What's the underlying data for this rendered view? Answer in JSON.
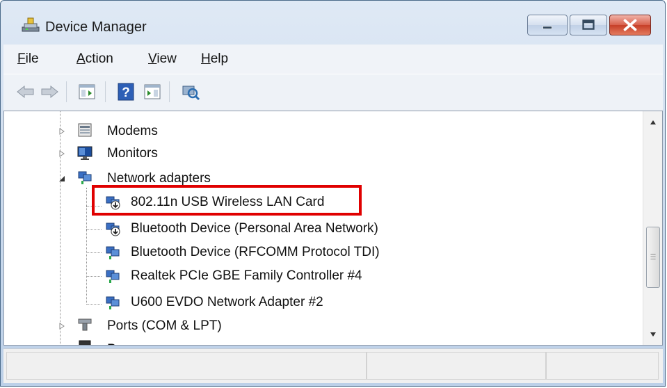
{
  "window": {
    "title": "Device Manager",
    "icon": "computer-management-icon"
  },
  "menu": {
    "items": [
      {
        "label": "File",
        "accel": "F"
      },
      {
        "label": "Action",
        "accel": "A"
      },
      {
        "label": "View",
        "accel": "V"
      },
      {
        "label": "Help",
        "accel": "H"
      }
    ]
  },
  "toolbar": {
    "buttons": [
      "back-icon",
      "forward-icon",
      "show-hide-console-tree-icon",
      "help-icon",
      "show-hide-action-pane-icon",
      "scan-hardware-changes-icon"
    ]
  },
  "tree": {
    "items": [
      {
        "label": "Modems",
        "icon": "modem-icon",
        "expanded": false
      },
      {
        "label": "Monitors",
        "icon": "monitor-icon",
        "expanded": false
      },
      {
        "label": "Network adapters",
        "icon": "network-adapter-icon",
        "expanded": true
      },
      {
        "label": "802.11n USB Wireless LAN Card",
        "icon": "network-adapter-disabled-icon",
        "highlighted": true
      },
      {
        "label": "Bluetooth Device (Personal Area Network)",
        "icon": "network-adapter-disabled-icon"
      },
      {
        "label": "Bluetooth Device (RFCOMM Protocol TDI)",
        "icon": "network-adapter-icon"
      },
      {
        "label": "Realtek PCIe GBE Family Controller #4",
        "icon": "network-adapter-icon"
      },
      {
        "label": "U600 EVDO Network Adapter #2",
        "icon": "network-adapter-icon"
      },
      {
        "label": "Ports (COM & LPT)",
        "icon": "port-icon",
        "expanded": false
      },
      {
        "label": "P",
        "icon": "processor-icon",
        "expanded": false
      }
    ]
  },
  "colors": {
    "highlight_border": "#e00000",
    "close_button": "#c63f28"
  }
}
